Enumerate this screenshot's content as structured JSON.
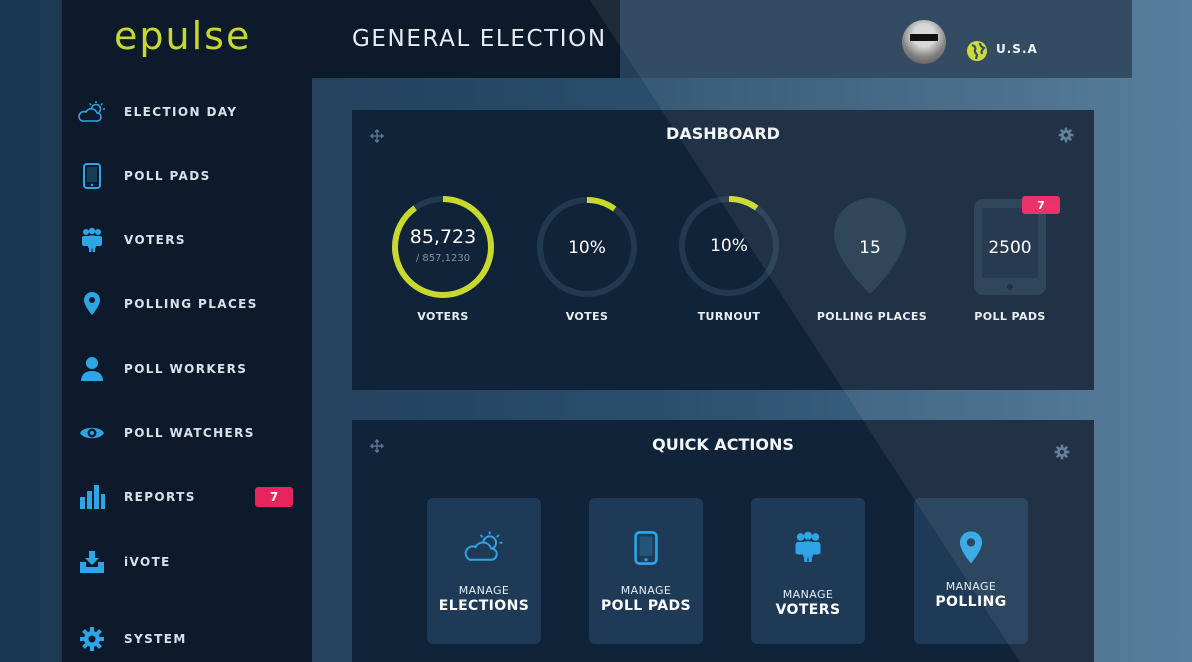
{
  "brand": {
    "logo": "epulse",
    "accent": "#c8d92e"
  },
  "header": {
    "title": "GENERAL ELECTION",
    "region": "U.S.A"
  },
  "sidebar": {
    "items": [
      {
        "label": "ELECTION DAY",
        "icon": "weather-cloud-sun-icon"
      },
      {
        "label": "POLL PADS",
        "icon": "tablet-icon"
      },
      {
        "label": "VOTERS",
        "icon": "people-icon"
      },
      {
        "label": "POLLING PLACES",
        "icon": "map-pin-icon"
      },
      {
        "label": "POLL WORKERS",
        "icon": "person-icon"
      },
      {
        "label": "POLL WATCHERS",
        "icon": "eye-icon"
      },
      {
        "label": "REPORTS",
        "icon": "bar-chart-icon",
        "badge": "7"
      },
      {
        "label": "iVOTE",
        "icon": "download-tray-icon"
      },
      {
        "label": "SYSTEM",
        "icon": "gear-icon"
      }
    ]
  },
  "dashboard": {
    "title": "DASHBOARD",
    "stats": [
      {
        "label": "VOTERS",
        "value": "85,723",
        "sub": "/ 857,1230",
        "progress": 0.9
      },
      {
        "label": "VOTES",
        "value": "10%",
        "progress": 0.1
      },
      {
        "label": "TURNOUT",
        "value": "10%",
        "progress": 0.1
      },
      {
        "label": "POLLING PLACES",
        "value": "15"
      },
      {
        "label": "POLL PADS",
        "value": "2500",
        "badge": "7"
      }
    ]
  },
  "quick_actions": {
    "title": "QUICK ACTIONS",
    "items": [
      {
        "line1": "MANAGE",
        "line2": "ELECTIONS"
      },
      {
        "line1": "MANAGE",
        "line2": "POLL PADS"
      },
      {
        "line1": "MANAGE",
        "line2": "VOTERS"
      },
      {
        "line1": "MANAGE",
        "line2": "POLLING"
      }
    ]
  },
  "colors": {
    "badge": "#e8245e",
    "ring_track": "#21384f",
    "icon": "#2ea6e6"
  }
}
